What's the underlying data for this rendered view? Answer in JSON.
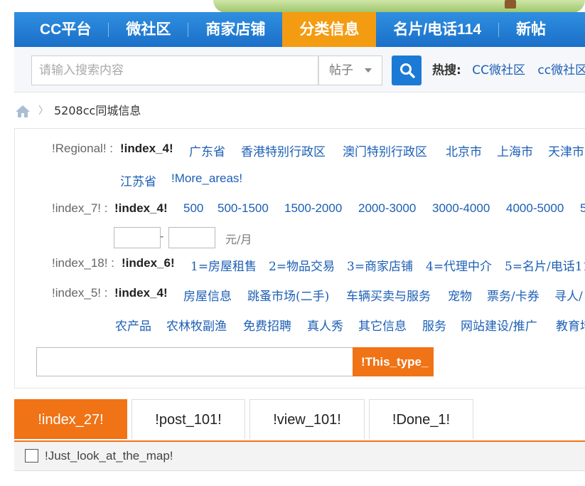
{
  "nav": {
    "items": [
      {
        "label": "CC平台",
        "active": false
      },
      {
        "label": "微社区",
        "active": false
      },
      {
        "label": "商家店铺",
        "active": false
      },
      {
        "label": "分类信息",
        "active": true
      },
      {
        "label": "名片/电话114",
        "active": false
      },
      {
        "label": "新帖",
        "active": false
      }
    ]
  },
  "search": {
    "placeholder": "请输入搜索内容",
    "type_selected": "帖子",
    "hot_label": "热搜:",
    "hot_links": [
      "CC微社区",
      "cc微社区"
    ]
  },
  "breadcrumb": {
    "current": "5208cc同城信息"
  },
  "filters": {
    "regional": {
      "label": "!Regional! :",
      "current": "!index_4!",
      "row1": [
        "广东省",
        "香港特别行政区",
        "澳门特别行政区",
        "北京市",
        "上海市",
        "天津市"
      ],
      "row2": [
        "江苏省"
      ],
      "more": "!More_areas!"
    },
    "price": {
      "label": "!index_7! :",
      "current": "!index_4!",
      "options": [
        "500",
        "500-1500",
        "1500-2000",
        "2000-3000",
        "3000-4000",
        "4000-5000",
        "5"
      ],
      "dash": "-",
      "unit": "元/月"
    },
    "type": {
      "label": "!index_18! :",
      "current": "!index_6!",
      "options": [
        "1=房屋租售",
        "2=物品交易",
        "3=商家店铺",
        "4=代理中介",
        "5=名片/电话11"
      ]
    },
    "category": {
      "label": "!index_5! :",
      "current": "!index_4!",
      "row1": [
        "房屋信息",
        "跳蚤市场(二手)",
        "车辆买卖与服务",
        "宠物",
        "票务/卡券",
        "寻人/"
      ],
      "row2": [
        "农产品",
        "农林牧副渔",
        "免费招聘",
        "真人秀",
        "其它信息",
        "服务",
        "网站建设/推广",
        "教育培"
      ]
    },
    "keyword_button": "!This_type_"
  },
  "tabs": [
    {
      "label": "!index_27!",
      "active": true
    },
    {
      "label": "!post_101!",
      "active": false
    },
    {
      "label": "!view_101!",
      "active": false
    },
    {
      "label": "!Done_1!",
      "active": false
    }
  ],
  "map": {
    "checkbox_label": "!Just_look_at_the_map!",
    "checked": false
  },
  "colors": {
    "nav_blue": "#1b6fc8",
    "accent_orange": "#f07316",
    "link_blue": "#1c5fb5"
  }
}
